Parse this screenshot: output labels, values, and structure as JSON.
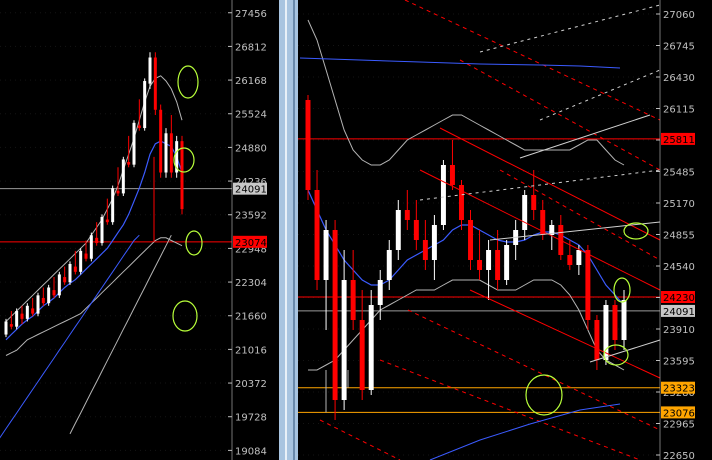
{
  "colors": {
    "background": "#000000",
    "bull_candle": "#ffffff",
    "bear_candle": "#ff0000",
    "axis_text": "#c0c0c0",
    "grid": "#ffffff",
    "ma_blue": "#3b5bff",
    "band": "#b4b4b4",
    "marker_green": "#b8ff3a",
    "red_line": "#ff0000",
    "orange_line": "#ffa500",
    "price_tag_red": "#ff0000",
    "price_tag_orange": "#ffa500",
    "price_tag_gray": "#c8c8c8",
    "splitter": "#a8c4e0"
  },
  "chart_data": [
    {
      "type": "candlestick",
      "title": "",
      "ylim": [
        18900,
        27700
      ],
      "y_ticks": [
        27456,
        26812,
        26168,
        25524,
        24880,
        24236,
        23592,
        22948,
        22304,
        21660,
        21016,
        20372,
        19728,
        19084
      ],
      "price_tags": [
        {
          "label": "24091",
          "value": 24091,
          "color": "gray"
        },
        {
          "label": "23074",
          "value": 23074,
          "color": "red"
        }
      ],
      "candles": [
        [
          21300,
          21600,
          21250,
          21550
        ],
        [
          21500,
          21750,
          21400,
          21450
        ],
        [
          21450,
          21800,
          21400,
          21750
        ],
        [
          21700,
          21850,
          21500,
          21600
        ],
        [
          21600,
          21900,
          21550,
          21850
        ],
        [
          21800,
          22000,
          21650,
          21700
        ],
        [
          21700,
          22100,
          21650,
          22050
        ],
        [
          22000,
          22200,
          21850,
          21900
        ],
        [
          21900,
          22250,
          21850,
          22200
        ],
        [
          22150,
          22400,
          22000,
          22050
        ],
        [
          22050,
          22500,
          22000,
          22450
        ],
        [
          22400,
          22600,
          22250,
          22300
        ],
        [
          22300,
          22700,
          22250,
          22650
        ],
        [
          22600,
          22900,
          22450,
          22500
        ],
        [
          22500,
          22950,
          22450,
          22900
        ],
        [
          22850,
          23100,
          22700,
          22750
        ],
        [
          22750,
          23250,
          22700,
          23200
        ],
        [
          23150,
          23450,
          23000,
          23050
        ],
        [
          23050,
          23600,
          23000,
          23550
        ],
        [
          23500,
          23900,
          23400,
          23450
        ],
        [
          23450,
          24150,
          23400,
          24100
        ],
        [
          24050,
          24500,
          23950,
          24000
        ],
        [
          24000,
          24700,
          23950,
          24650
        ],
        [
          24600,
          25100,
          24500,
          24550
        ],
        [
          24550,
          25400,
          24500,
          25350
        ],
        [
          25300,
          25800,
          25200,
          25250
        ],
        [
          25250,
          26200,
          25200,
          26150
        ],
        [
          26100,
          26700,
          26000,
          26600
        ],
        [
          26600,
          26700,
          25500,
          25600
        ],
        [
          25600,
          25700,
          24300,
          24400
        ],
        [
          24400,
          25250,
          24300,
          25150
        ],
        [
          25150,
          25500,
          24300,
          24400
        ],
        [
          24400,
          25100,
          24300,
          25000
        ],
        [
          25000,
          25100,
          23600,
          23700
        ]
      ],
      "ma_line": [
        21200,
        21300,
        21400,
        21500,
        21580,
        21650,
        21750,
        21850,
        21920,
        22000,
        22100,
        22200,
        22280,
        22350,
        22450,
        22550,
        22650,
        22750,
        22850,
        22950,
        23100,
        23250,
        23400,
        23600,
        23850,
        24100,
        24400,
        24750,
        24950,
        25000,
        24950,
        24900,
        24700,
        24400
      ],
      "band_upper": [
        21550,
        21650,
        21750,
        21850,
        21950,
        22050,
        22150,
        22250,
        22350,
        22450,
        22550,
        22650,
        22750,
        22850,
        22950,
        23050,
        23200,
        23350,
        23500,
        23700,
        23900,
        24150,
        24450,
        24750,
        25050,
        25400,
        25750,
        26050,
        26200,
        26250,
        26150,
        26000,
        25750,
        25400
      ],
      "band_lower": [
        20900,
        20950,
        21000,
        21100,
        21200,
        21250,
        21300,
        21350,
        21400,
        21450,
        21500,
        21550,
        21600,
        21650,
        21700,
        21800,
        21900,
        22000,
        22100,
        22200,
        22300,
        22400,
        22500,
        22600,
        22700,
        22800,
        22900,
        23000,
        23100,
        23150,
        23150,
        23100,
        23050,
        23000
      ],
      "lower_band2": [
        19400,
        19600,
        19800,
        20000,
        20200,
        20400,
        20600,
        20800,
        21000,
        21200,
        21400,
        21600,
        21800,
        22000,
        22200,
        22400,
        22600,
        22800,
        23000,
        23200
      ],
      "lower_band3": [
        18900,
        19050,
        19200,
        19350,
        19500,
        19650,
        19800,
        19950,
        20100,
        20250,
        20400,
        20550,
        20700,
        20850,
        21000,
        21150,
        21300,
        21450,
        21600,
        21750,
        21900,
        22050,
        22200,
        22350,
        22500,
        22650,
        22800,
        22950,
        23100,
        23200
      ],
      "hlines": [
        {
          "value": 24091,
          "color": "gray"
        },
        {
          "value": 23074,
          "color": "red"
        }
      ]
    },
    {
      "type": "candlestick",
      "title": "",
      "ylim": [
        22600,
        27200
      ],
      "y_ticks": [
        27060,
        26745,
        26430,
        26115,
        25800,
        25485,
        25170,
        24855,
        24540,
        24225,
        23910,
        23595,
        23280,
        22965,
        22650
      ],
      "price_tags": [
        {
          "label": "25811",
          "value": 25811,
          "color": "red"
        },
        {
          "label": "24230",
          "value": 24230,
          "color": "red"
        },
        {
          "label": "24091",
          "value": 24091,
          "color": "gray"
        },
        {
          "label": "23323",
          "value": 23323,
          "color": "orange"
        },
        {
          "label": "23076",
          "value": 23076,
          "color": "orange"
        }
      ],
      "candles": [
        [
          26200,
          26250,
          25200,
          25300
        ],
        [
          25300,
          25500,
          24300,
          24400
        ],
        [
          24400,
          25000,
          23900,
          24900
        ],
        [
          24900,
          25000,
          23000,
          23200
        ],
        [
          23200,
          24700,
          23100,
          24400
        ],
        [
          24400,
          24700,
          23900,
          24000
        ],
        [
          24000,
          24300,
          23200,
          23300
        ],
        [
          23300,
          24300,
          23250,
          24150
        ],
        [
          24150,
          24500,
          24000,
          24400
        ],
        [
          24400,
          24800,
          24300,
          24700
        ],
        [
          24700,
          25200,
          24600,
          25100
        ],
        [
          25100,
          25300,
          24900,
          25000
        ],
        [
          25000,
          25200,
          24700,
          24800
        ],
        [
          24800,
          25000,
          24500,
          24600
        ],
        [
          24600,
          25050,
          24400,
          24950
        ],
        [
          24950,
          25600,
          24900,
          25550
        ],
        [
          25550,
          25800,
          25300,
          25350
        ],
        [
          25350,
          25400,
          24900,
          25000
        ],
        [
          25000,
          25100,
          24500,
          24600
        ],
        [
          24600,
          24900,
          24400,
          24500
        ],
        [
          24500,
          24800,
          24200,
          24700
        ],
        [
          24700,
          24900,
          24300,
          24400
        ],
        [
          24400,
          24800,
          24350,
          24750
        ],
        [
          24750,
          25000,
          24600,
          24900
        ],
        [
          24900,
          25300,
          24800,
          25250
        ],
        [
          25250,
          25500,
          25000,
          25100
        ],
        [
          25100,
          25200,
          24800,
          24850
        ],
        [
          24850,
          25000,
          24700,
          24950
        ],
        [
          24950,
          25050,
          24600,
          24650
        ],
        [
          24650,
          24800,
          24500,
          24550
        ],
        [
          24550,
          24750,
          24450,
          24700
        ],
        [
          24700,
          24750,
          23900,
          24000
        ],
        [
          24000,
          24050,
          23500,
          23600
        ],
        [
          23600,
          24200,
          23550,
          24150
        ],
        [
          24150,
          24200,
          23700,
          23800
        ],
        [
          23800,
          24300,
          23700,
          24200
        ]
      ],
      "ma_line": [
        25300,
        25100,
        24900,
        24750,
        24600,
        24500,
        24400,
        24350,
        24350,
        24400,
        24500,
        24600,
        24650,
        24700,
        24750,
        24800,
        24900,
        24950,
        24950,
        24900,
        24850,
        24800,
        24780,
        24780,
        24800,
        24850,
        24880,
        24880,
        24850,
        24800,
        24750,
        24650,
        24500,
        24350,
        24250,
        24150
      ],
      "band_upper": [
        27000,
        26800,
        26500,
        26200,
        25900,
        25700,
        25600,
        25550,
        25550,
        25600,
        25700,
        25800,
        25850,
        25900,
        25950,
        26000,
        26050,
        26050,
        26000,
        25950,
        25900,
        25850,
        25800,
        25750,
        25700,
        25700,
        25700,
        25700,
        25700,
        25700,
        25750,
        25800,
        25800,
        25700,
        25600,
        25550
      ],
      "band_lower": [
        23500,
        23500,
        23550,
        23600,
        23700,
        23800,
        23900,
        24000,
        24100,
        24150,
        24200,
        24250,
        24300,
        24300,
        24300,
        24350,
        24400,
        24400,
        24400,
        24400,
        24350,
        24300,
        24300,
        24300,
        24350,
        24400,
        24400,
        24400,
        24350,
        24250,
        24100,
        23900,
        23700,
        23600,
        23550,
        23500
      ],
      "hlines": [
        {
          "value": 25811,
          "color": "red"
        },
        {
          "value": 24230,
          "color": "red"
        },
        {
          "value": 24091,
          "color": "gray"
        },
        {
          "value": 23323,
          "color": "orange"
        },
        {
          "value": 23076,
          "color": "orange"
        }
      ]
    }
  ]
}
